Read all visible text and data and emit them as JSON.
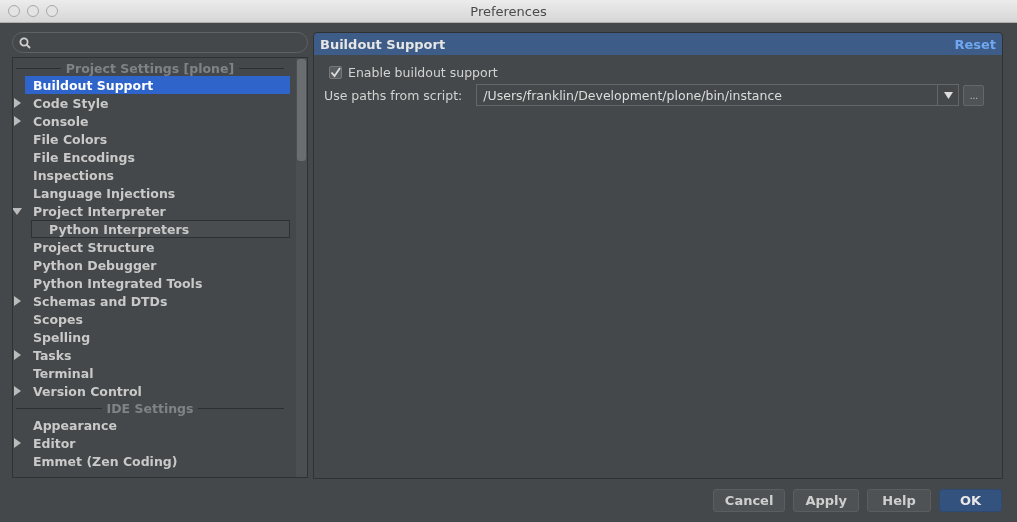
{
  "window": {
    "title": "Preferences"
  },
  "tree": [
    {
      "kind": "header",
      "label": "Project Settings [plone]"
    },
    {
      "kind": "item",
      "label": "Buildout Support",
      "selected": true
    },
    {
      "kind": "item",
      "label": "Code Style",
      "expanded": false,
      "selected": false
    },
    {
      "kind": "item",
      "label": "Console",
      "expanded": false,
      "selected": false
    },
    {
      "kind": "item",
      "label": "File Colors",
      "selected": false
    },
    {
      "kind": "item",
      "label": "File Encodings",
      "selected": false
    },
    {
      "kind": "item",
      "label": "Inspections",
      "selected": false
    },
    {
      "kind": "item",
      "label": "Language Injections",
      "selected": false
    },
    {
      "kind": "item",
      "label": "Project Interpreter",
      "expanded": true,
      "selected": false,
      "children": [
        {
          "kind": "item",
          "label": "Python Interpreters",
          "selected": false
        }
      ]
    },
    {
      "kind": "item",
      "label": "Project Structure",
      "selected": false
    },
    {
      "kind": "item",
      "label": "Python Debugger",
      "selected": false
    },
    {
      "kind": "item",
      "label": "Python Integrated Tools",
      "selected": false
    },
    {
      "kind": "item",
      "label": "Schemas and DTDs",
      "expanded": false,
      "selected": false
    },
    {
      "kind": "item",
      "label": "Scopes",
      "selected": false
    },
    {
      "kind": "item",
      "label": "Spelling",
      "selected": false
    },
    {
      "kind": "item",
      "label": "Tasks",
      "expanded": false,
      "selected": false
    },
    {
      "kind": "item",
      "label": "Terminal",
      "selected": false
    },
    {
      "kind": "item",
      "label": "Version Control",
      "expanded": false,
      "selected": false
    },
    {
      "kind": "header",
      "label": "IDE Settings"
    },
    {
      "kind": "item",
      "label": "Appearance",
      "selected": false
    },
    {
      "kind": "item",
      "label": "Editor",
      "expanded": false,
      "selected": false
    },
    {
      "kind": "item",
      "label": "Emmet (Zen Coding)",
      "selected": false
    }
  ],
  "panel": {
    "title": "Buildout Support",
    "reset": "Reset",
    "enable": {
      "label": "Enable buildout support",
      "checked": true
    },
    "script": {
      "label": "Use paths from script:",
      "value": "/Users/franklin/Development/plone/bin/instance",
      "browse": "..."
    }
  },
  "buttons": [
    {
      "label": "Cancel",
      "default": false
    },
    {
      "label": "Apply",
      "default": false
    },
    {
      "label": "Help",
      "default": false
    },
    {
      "label": "OK",
      "default": true
    }
  ]
}
